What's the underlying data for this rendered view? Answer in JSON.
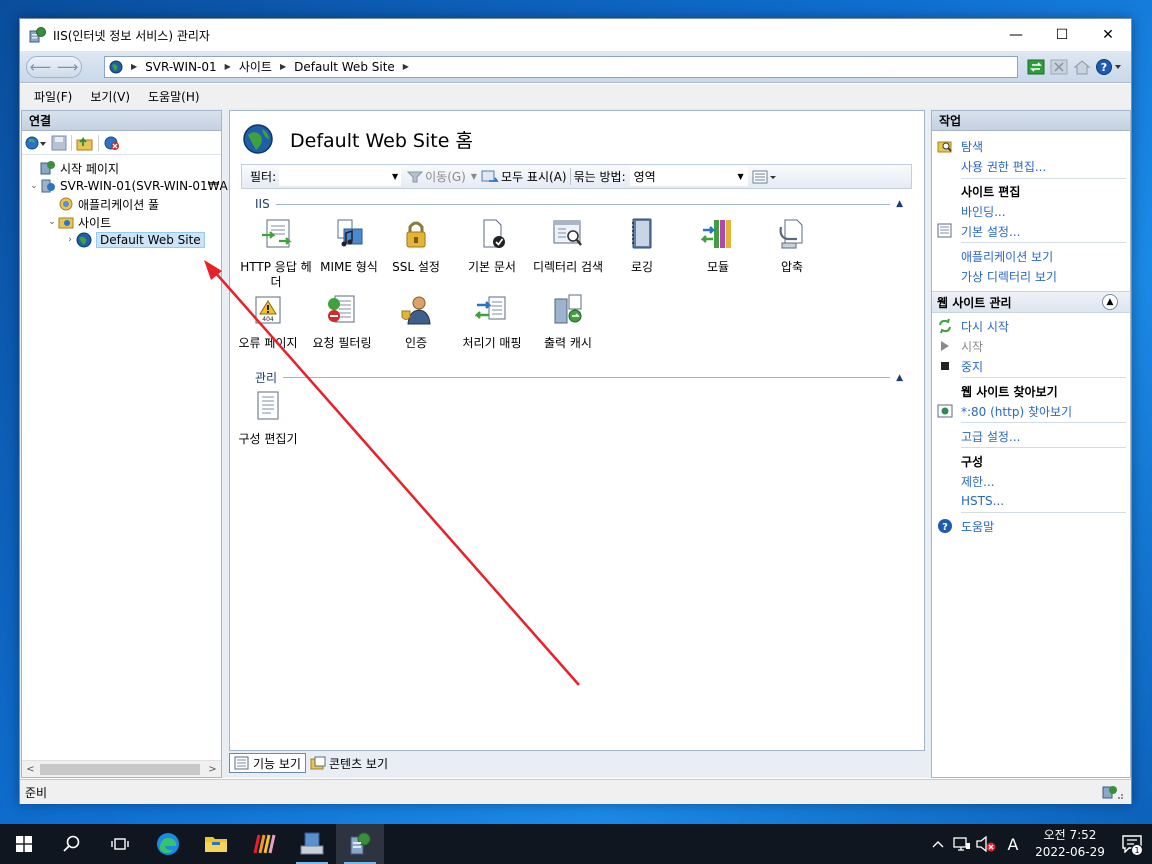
{
  "window": {
    "title": "IIS(인터넷 정보 서비스) 관리자",
    "controls": {
      "minimize": "—",
      "maximize": "☐",
      "close": "✕"
    }
  },
  "address": {
    "crumbs": [
      "SVR-WIN-01",
      "사이트",
      "Default Web Site"
    ]
  },
  "menu": [
    "파일(F)",
    "보기(V)",
    "도움말(H)"
  ],
  "connections": {
    "header": "연결",
    "tree": [
      {
        "label": "시작 페이지"
      },
      {
        "label": "SVR-WIN-01(SVR-WIN-01₩A"
      },
      {
        "label": "애플리케이션 풀"
      },
      {
        "label": "사이트"
      },
      {
        "label": "Default Web Site"
      }
    ]
  },
  "center": {
    "title": "Default Web Site 홈",
    "filter_label": "필터:",
    "go_label": "이동(G)",
    "show_all_label": "모두 표시(A)",
    "group_by_label": "묶는 방법:",
    "group_by_value": "영역",
    "sections": [
      {
        "name": "IIS"
      },
      {
        "name": "관리"
      }
    ],
    "features_iis": [
      {
        "label": "HTTP 응답 헤더"
      },
      {
        "label": "MIME 형식"
      },
      {
        "label": "SSL 설정"
      },
      {
        "label": "기본 문서"
      },
      {
        "label": "디렉터리 검색"
      },
      {
        "label": "로깅"
      },
      {
        "label": "모듈"
      },
      {
        "label": "압축"
      },
      {
        "label": "오류 페이지"
      },
      {
        "label": "요청 필터링"
      },
      {
        "label": "인증"
      },
      {
        "label": "처리기 매핑"
      },
      {
        "label": "출력 캐시"
      }
    ],
    "features_mgmt": [
      {
        "label": "구성 편집기"
      }
    ],
    "view_tabs": {
      "features": "기능 보기",
      "content": "콘텐츠 보기"
    }
  },
  "actions": {
    "header": "작업",
    "explore": "탐색",
    "edit_permissions": "사용 권한 편집...",
    "edit_site_heading": "사이트 편집",
    "bindings": "바인딩...",
    "basic_settings": "기본 설정...",
    "view_applications": "애플리케이션 보기",
    "view_vdirs": "가상 디렉터리 보기",
    "manage_header": "웹 사이트 관리",
    "restart": "다시 시작",
    "start": "시작",
    "stop": "중지",
    "browse_heading": "웹 사이트 찾아보기",
    "browse_80": "*:80 (http) 찾아보기",
    "advanced_settings": "고급 설정...",
    "config_heading": "구성",
    "limits": "제한...",
    "hsts": "HSTS...",
    "help": "도움말"
  },
  "status": {
    "text": "준비"
  },
  "taskbar": {
    "clock_time": "오전 7:52",
    "clock_date": "2022-06-29",
    "ime": "A",
    "notification_count": "1"
  },
  "colors": {
    "link": "#2a66c9",
    "accent": "#0078d7",
    "arrow": "#e8202a"
  }
}
